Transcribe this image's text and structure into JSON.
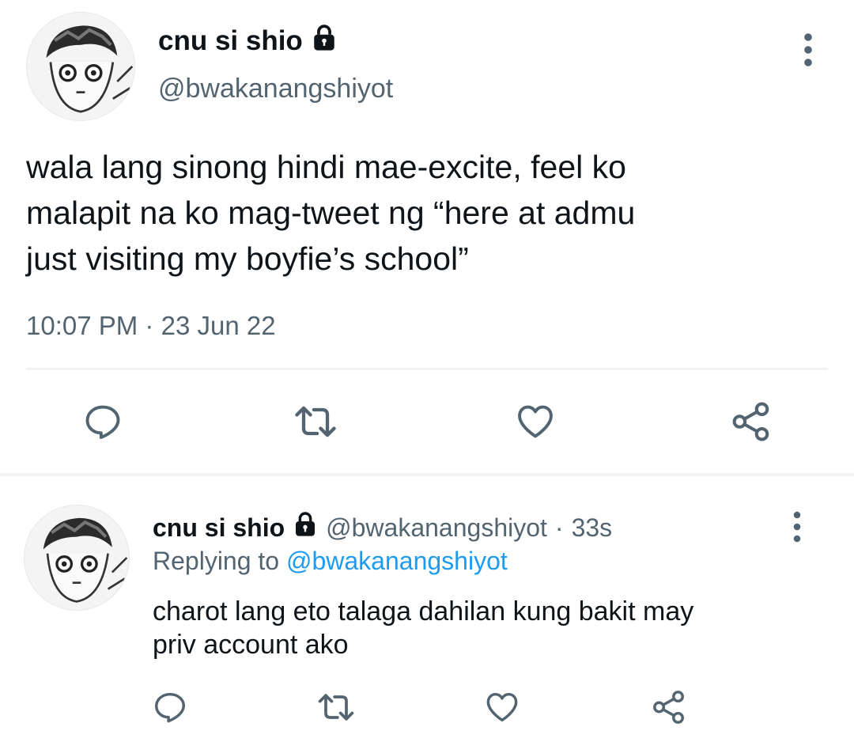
{
  "main_tweet": {
    "display_name": "cnu si shio",
    "handle": "@bwakanangshiyot",
    "text": "wala lang sinong hindi mae-excite, feel ko\nmalapit na ko mag-tweet ng “here at admu\njust visiting my boyfie’s school”",
    "time": "10:07 PM",
    "separator": "·",
    "date": "23 Jun 22"
  },
  "reply_tweet": {
    "display_name": "cnu si shio",
    "handle": "@bwakanangshiyot",
    "separator": "·",
    "age": "33s",
    "replying_label": "Replying to",
    "replying_handle": "@bwakanangshiyot",
    "text": "charot lang eto talaga dahilan kung bakit may\npriv account ako"
  },
  "icons": {
    "reply": "reply-icon",
    "retweet": "retweet-icon",
    "like": "like-icon",
    "share": "share-icon",
    "more": "more-vertical-icon",
    "lock": "lock-icon"
  },
  "colors": {
    "text": "#0f1419",
    "secondary": "#536471",
    "accent": "#1d9bf0",
    "divider": "#eff3f4"
  }
}
